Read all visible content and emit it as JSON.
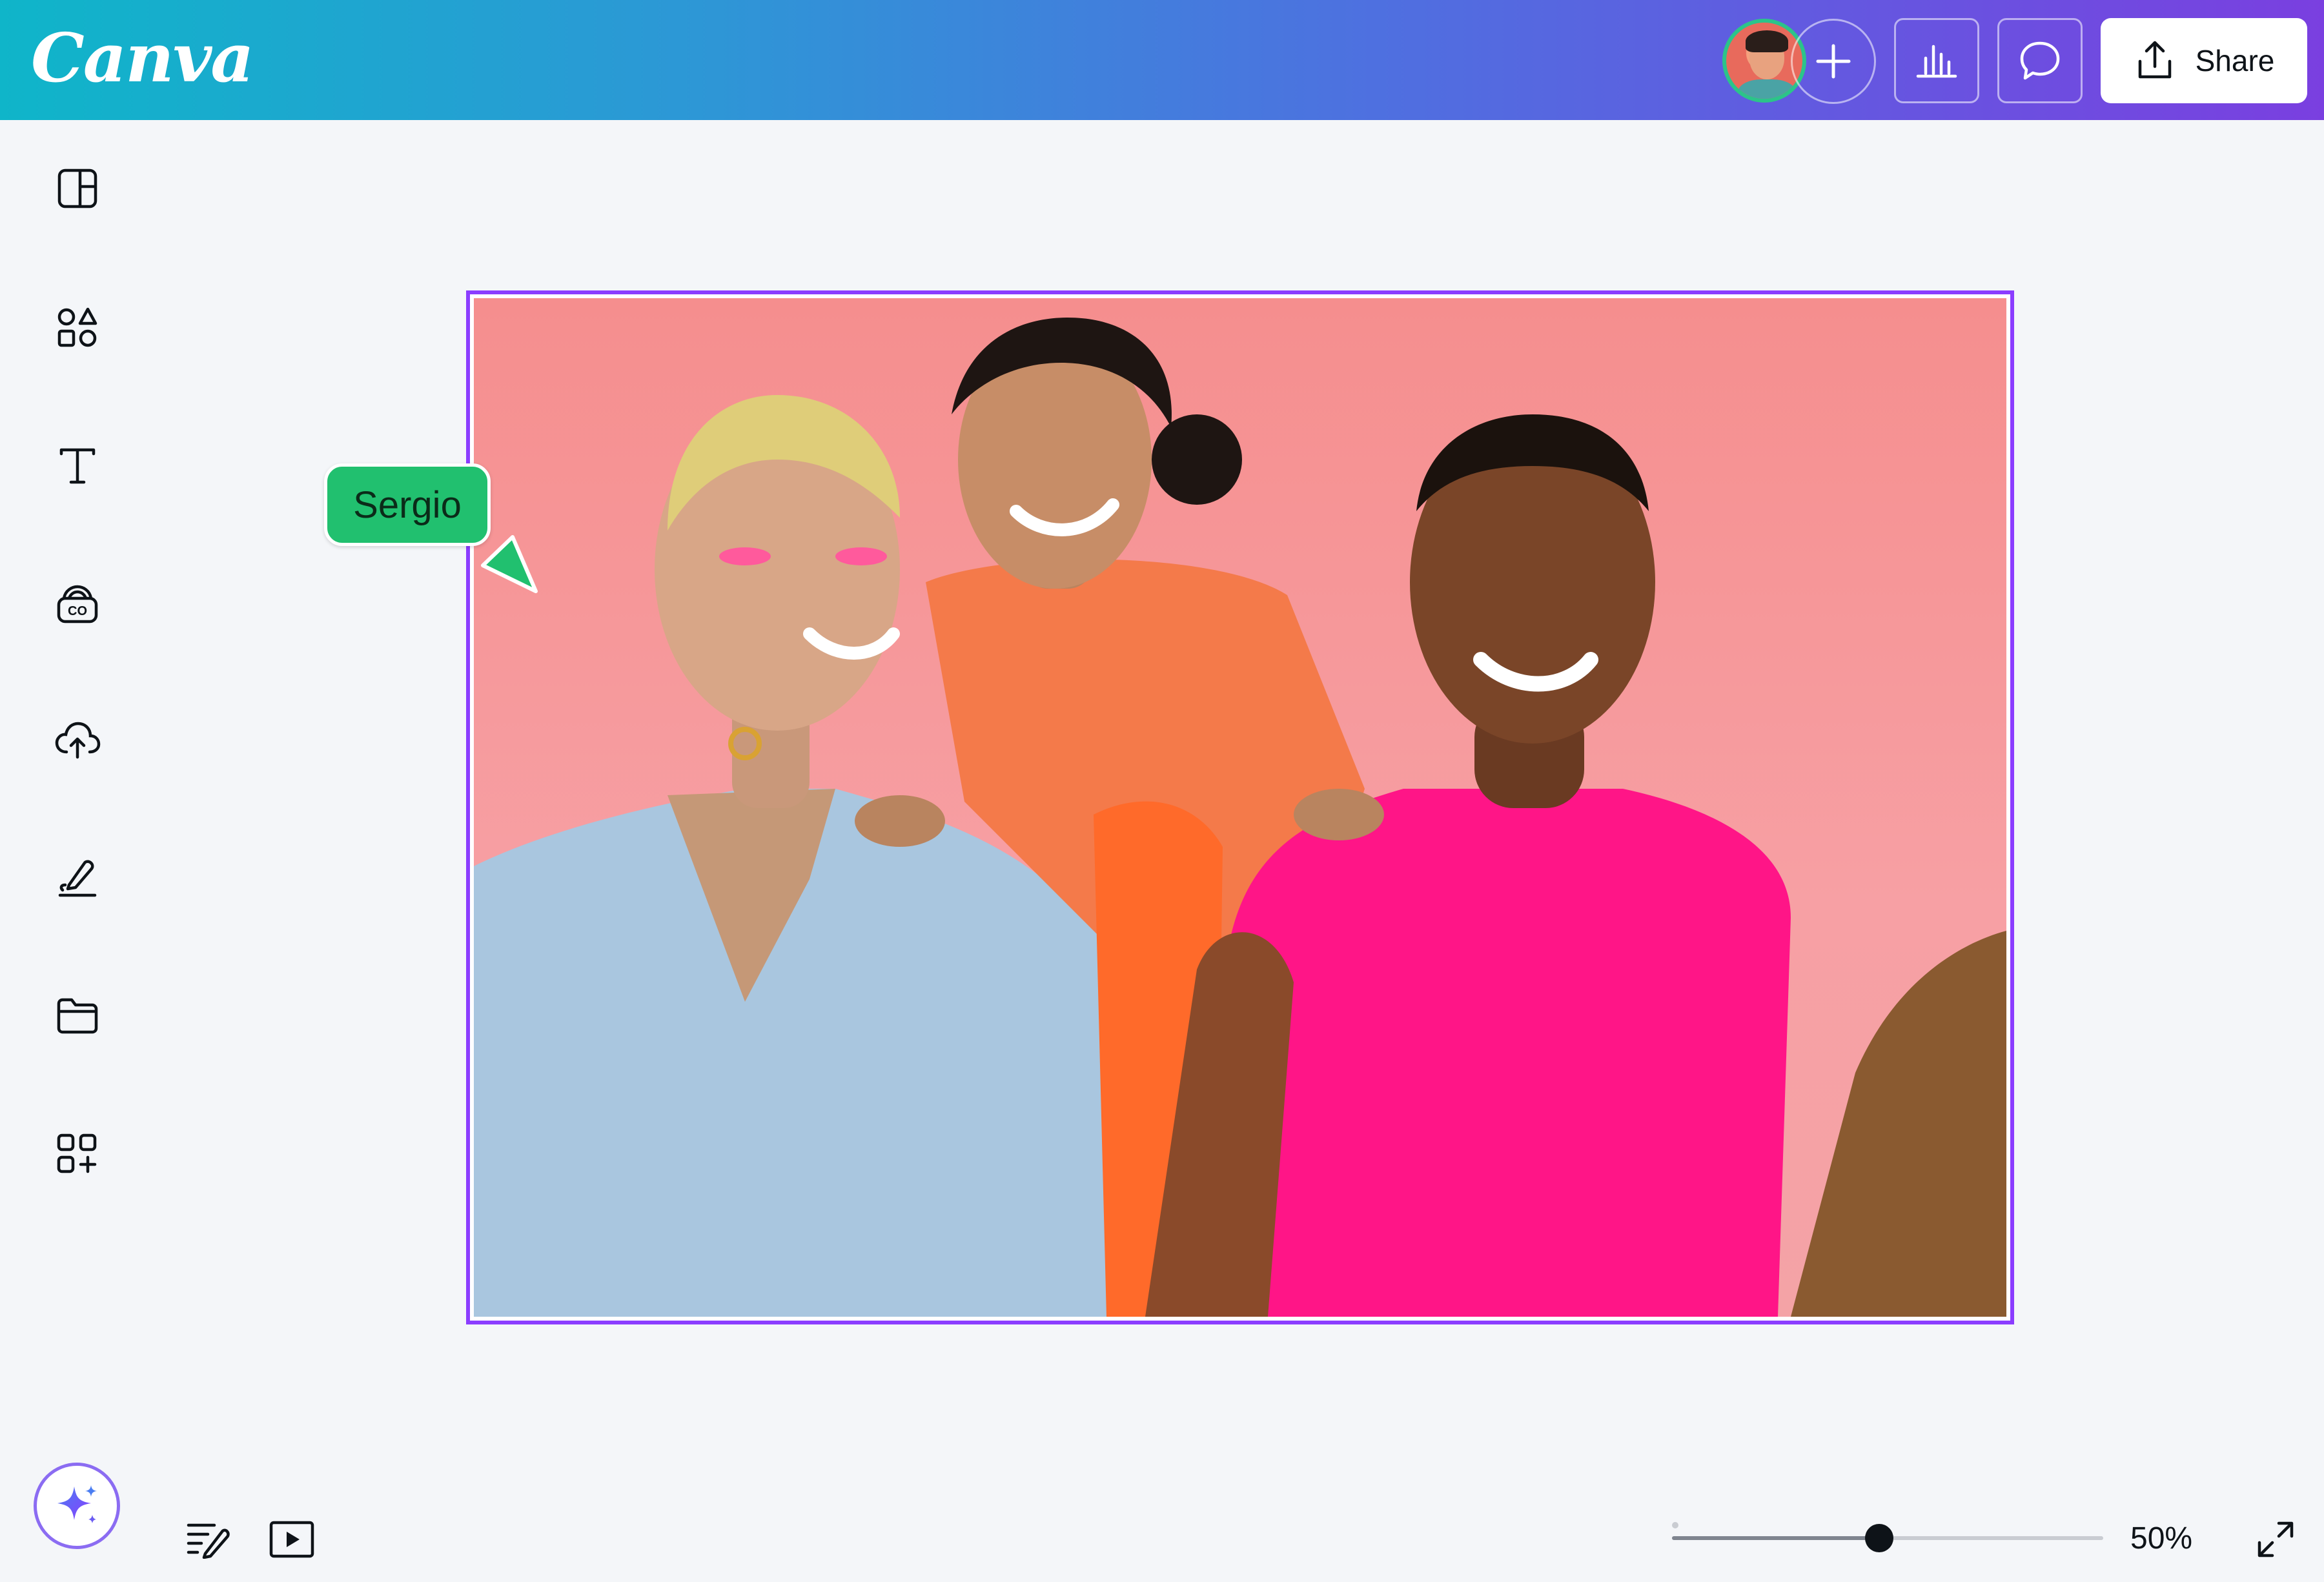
{
  "header": {
    "logo": "Canva",
    "share_label": "Share",
    "icons": {
      "add": "plus-icon",
      "insights": "bar-chart-icon",
      "comment": "comment-icon",
      "share": "upload-icon"
    }
  },
  "sidebar": {
    "items": [
      {
        "name": "design",
        "icon": "layout-icon"
      },
      {
        "name": "elements",
        "icon": "shapes-icon"
      },
      {
        "name": "text",
        "icon": "text-icon"
      },
      {
        "name": "brand",
        "icon": "brand-kit-icon"
      },
      {
        "name": "uploads",
        "icon": "cloud-upload-icon"
      },
      {
        "name": "draw",
        "icon": "draw-icon"
      },
      {
        "name": "projects",
        "icon": "folder-icon"
      },
      {
        "name": "apps",
        "icon": "apps-icon"
      }
    ]
  },
  "collaborator": {
    "name": "Sergio",
    "color": "#21c06f"
  },
  "footer": {
    "zoom_label": "50%",
    "zoom_fraction": 0.48,
    "icons": {
      "magic": "sparkle-icon",
      "notes": "notes-icon",
      "present": "play-icon",
      "fullscreen": "expand-icon"
    }
  },
  "colors": {
    "selection": "#8b3dff",
    "header_start": "#0fb5c9",
    "header_end": "#7a3fe0"
  }
}
